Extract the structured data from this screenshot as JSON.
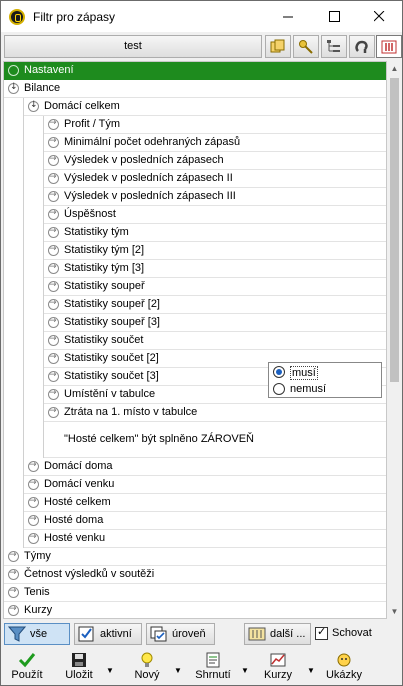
{
  "window": {
    "title": "Filtr pro zápasy"
  },
  "toolbar": {
    "search_value": "test"
  },
  "tree": {
    "settings": "Nastavení",
    "bilance": "Bilance",
    "domaci_celkem": "Domácí celkem",
    "leaf_items": [
      "Profit / Tým",
      "Minimální počet odehraných zápasů",
      "Výsledek v posledních zápasech",
      "Výsledek v posledních zápasech II",
      "Výsledek v posledních zápasech III",
      "Úspěšnost",
      "Statistiky tým",
      "Statistiky tým [2]",
      "Statistiky tým [3]",
      "Statistiky soupeř",
      "Statistiky soupeř [2]",
      "Statistiky soupeř [3]",
      "Statistiky součet",
      "Statistiky součet [2]",
      "Statistiky součet [3]",
      "Umístění v tabulce",
      "Ztráta na 1. místo v tabulce"
    ],
    "condition_label": "\"Hosté celkem\" být splněno ZÁROVEŇ",
    "radio_options": [
      "musí",
      "nemusí"
    ],
    "bilance_items": [
      "Domácí doma",
      "Domácí venku",
      "Hosté celkem",
      "Hosté doma",
      "Hosté venku"
    ],
    "root_items": [
      "Týmy",
      "Četnost výsledků v soutěži",
      "Tenis",
      "Kurzy"
    ]
  },
  "filterbar": {
    "all": "vše",
    "active": "aktivní",
    "level": "úroveň",
    "more": "další ...",
    "schovat": "Schovat"
  },
  "actions": {
    "use": "Použít",
    "save": "Uložit",
    "new": "Nový",
    "summary": "Shrnutí",
    "odds": "Kurzy",
    "examples": "Ukázky"
  },
  "colors": {
    "selected_row": "#1e8b1e",
    "accent": "#1a5fbf"
  }
}
